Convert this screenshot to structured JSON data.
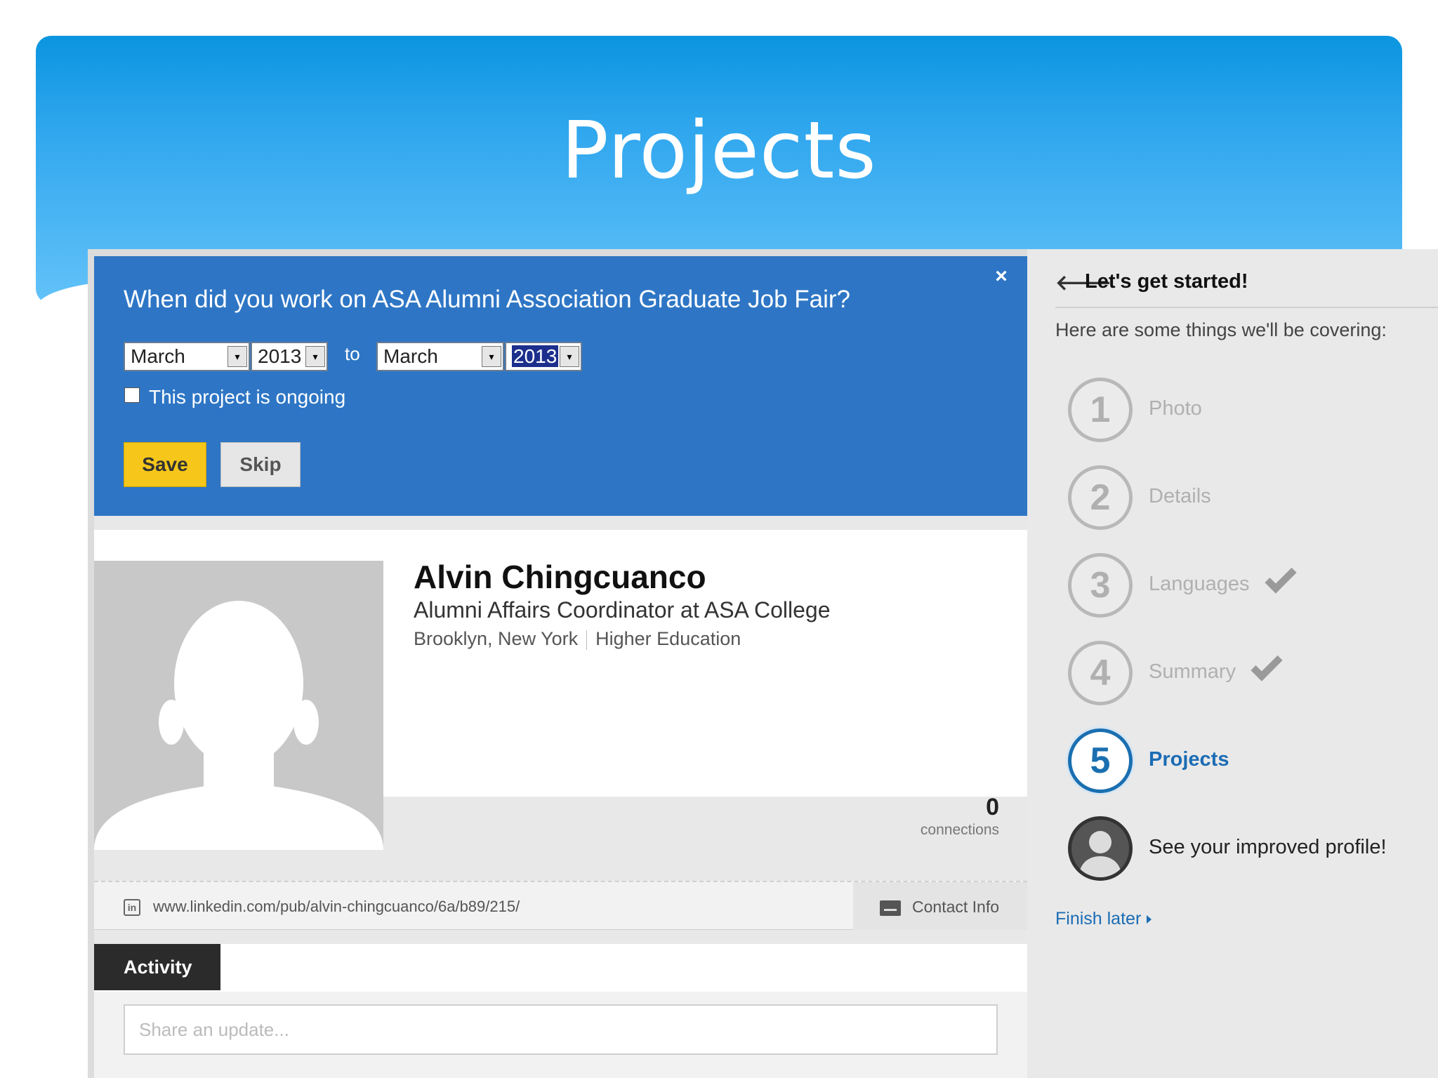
{
  "slide": {
    "title": "Projects"
  },
  "edit_panel": {
    "question": "When did you work on ASA Alumni Association Graduate Job Fair?",
    "start_month": "March",
    "start_year": "2013",
    "to_label": "to",
    "end_month": "March",
    "end_year": "2013",
    "ongoing_label": "This project is ongoing",
    "ongoing_checked": false,
    "save_label": "Save",
    "skip_label": "Skip",
    "close_glyph": "×",
    "dropdown_glyph": "▾"
  },
  "profile": {
    "name": "Alvin Chingcuanco",
    "headline": "Alumni Affairs Coordinator at ASA College",
    "location": "Brooklyn, New York",
    "industry": "Higher Education",
    "connections_count": "0",
    "connections_label": "connections",
    "public_url": "www.linkedin.com/pub/alvin-chingcuanco/6a/b89/215/",
    "linkedin_glyph": "in",
    "contact_info_label": "Contact Info"
  },
  "activity": {
    "tab_label": "Activity",
    "share_placeholder": "Share an update..."
  },
  "sidebar": {
    "back_glyph": "🡐",
    "title": "Let's get started!",
    "subtitle": "Here are some things we'll be covering:",
    "steps": [
      {
        "number": "1",
        "label": "Photo",
        "done": false,
        "active": false
      },
      {
        "number": "2",
        "label": "Details",
        "done": false,
        "active": false
      },
      {
        "number": "3",
        "label": "Languages",
        "done": true,
        "active": false
      },
      {
        "number": "4",
        "label": "Summary",
        "done": true,
        "active": false
      },
      {
        "number": "5",
        "label": "Projects",
        "done": false,
        "active": true
      }
    ],
    "final_step_label": "See your improved profile!",
    "finish_later_label": "Finish later"
  },
  "colors": {
    "header_blue": "#0b95e0",
    "panel_blue": "#2e76c5",
    "save_yellow": "#f6c71a",
    "link_blue": "#1b6cb4"
  }
}
